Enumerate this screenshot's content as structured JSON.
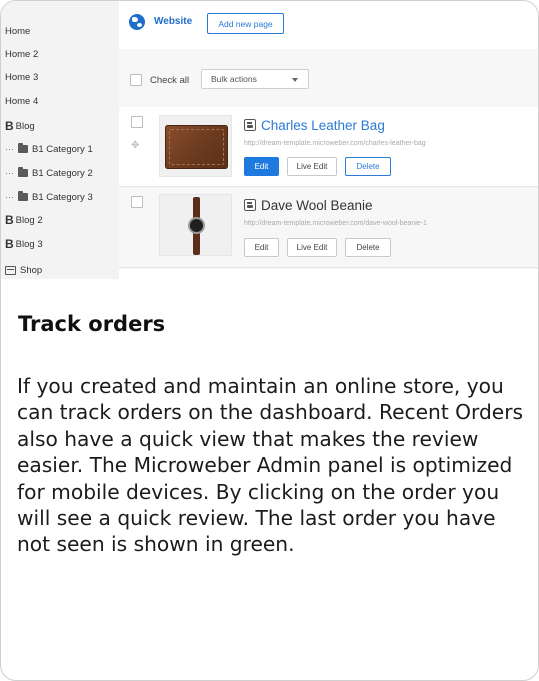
{
  "sidebar": {
    "items": [
      {
        "label": "Home"
      },
      {
        "label": "Home 2"
      },
      {
        "label": "Home 3"
      },
      {
        "label": "Home 4"
      },
      {
        "label": "Blog",
        "prefix": "B"
      },
      {
        "label": "B1 Category 1"
      },
      {
        "label": "B1 Category 2"
      },
      {
        "label": "B1 Category 3"
      },
      {
        "label": "Blog 2",
        "prefix": "B"
      },
      {
        "label": "Blog 3",
        "prefix": "B"
      },
      {
        "label": "Shop"
      }
    ],
    "tree_marker": "⋯"
  },
  "header": {
    "title": "Website",
    "add_page_label": "Add new page"
  },
  "toolbar": {
    "check_all_label": "Check all",
    "bulk_actions_label": "Bulk actions"
  },
  "products": [
    {
      "title": "Charles Leather Bag",
      "url": "http://dream-template.microweber.com/charles-leather-bag",
      "edit_label": "Edit",
      "live_edit_label": "Live Edit",
      "delete_label": "Delete"
    },
    {
      "title": "Dave Wool Beanie",
      "url": "http://dream-template.microweber.com/dave-wool-beanie-1",
      "edit_label": "Edit",
      "live_edit_label": "Live Edit",
      "delete_label": "Delete"
    }
  ],
  "article": {
    "heading": "Track orders",
    "body": "If you created and maintain an online store, you can track orders on the dashboard. Recent Orders also have a quick view that makes the review easier. The Microweber Admin panel is optimized for mobile devices. By clicking on the order you will see a quick review. The last order you have not seen is shown in green."
  },
  "icons": {
    "globe": "globe-icon",
    "page": "page-icon",
    "folder": "folder-icon",
    "shop": "shop-icon",
    "move": "move-handle-icon"
  },
  "colors": {
    "accent": "#1f7ae0",
    "link": "#2a7ad6"
  }
}
